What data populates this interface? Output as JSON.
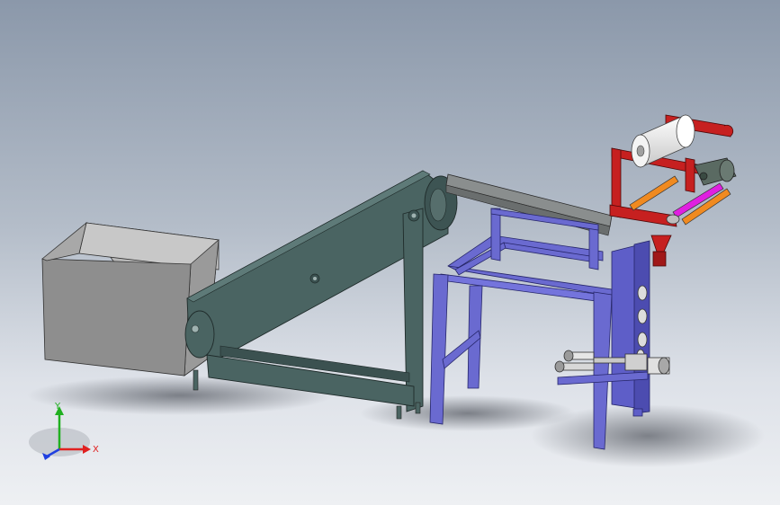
{
  "viewport": {
    "background_top": "#8b98aa",
    "background_bottom": "#eef0f3"
  },
  "triad": {
    "x_label": "X",
    "y_label": "Y",
    "x_color": "#e02020",
    "y_color": "#20b020",
    "z_color": "#2040e0"
  },
  "colors": {
    "hopper": "#8e8e8e",
    "conveyor": "#4a6462",
    "frame": "#6a6ad0",
    "rack": "#c62020",
    "roll": "#f0f0f0",
    "roller_orange": "#f08a20",
    "roller_magenta": "#e020e0",
    "belt": "#7a7e7e"
  }
}
